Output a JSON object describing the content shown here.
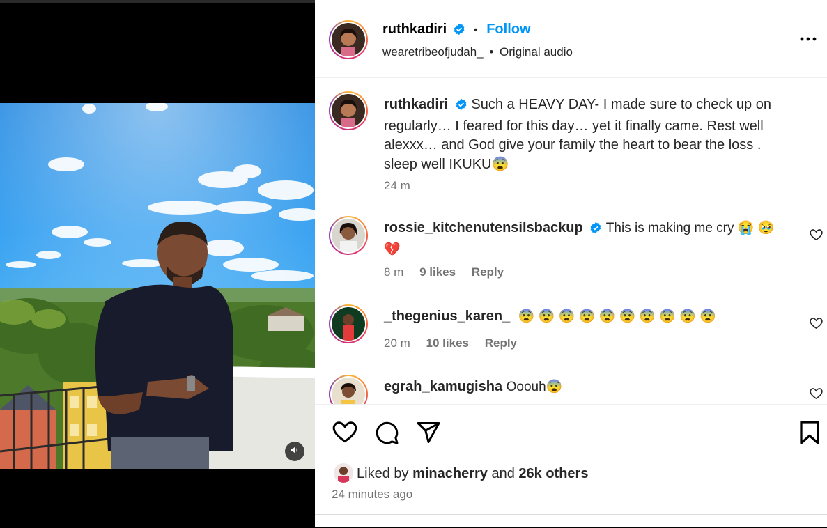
{
  "post": {
    "author": "ruthkadiri",
    "follow_label": "Follow",
    "audio_owner": "wearetribeofjudah_",
    "audio_separator": "•",
    "audio_label": "Original audio"
  },
  "caption": {
    "username": "ruthkadiri",
    "text": "Such a HEAVY DAY- I made sure to check up on regularly… I feared for this day… yet it finally came. Rest well alexxx… and God give your family the heart to bear the loss . sleep well IKUKU😨",
    "time": "24 m"
  },
  "comments": [
    {
      "username": "rossie_kitchenutensilsbackup",
      "verified": true,
      "text": "This is making me cry 😭 🥹 💔",
      "time": "8 m",
      "likes": "9 likes",
      "reply": "Reply"
    },
    {
      "username": "_thegenius_karen_",
      "verified": false,
      "text": "😨 😨 😨 😨 😨 😨 😨 😨 😨 😨",
      "time": "20 m",
      "likes": "10 likes",
      "reply": "Reply"
    },
    {
      "username": "egrah_kamugisha",
      "verified": false,
      "text": "Ooouh😨",
      "time": "",
      "likes": "",
      "reply": ""
    }
  ],
  "footer": {
    "liked_prefix": "Liked by",
    "liked_user": "minacherry",
    "liked_and": "and",
    "liked_count": "26k others",
    "timestamp": "24 minutes ago"
  },
  "icons": {
    "verified": "verified-badge-icon",
    "more": "more-options-icon",
    "like": "heart-icon",
    "comment": "comment-icon",
    "share": "share-icon",
    "save": "bookmark-icon",
    "audio": "speaker-icon"
  },
  "colors": {
    "accent": "#0095f6",
    "text": "#262626",
    "muted": "#737373"
  }
}
